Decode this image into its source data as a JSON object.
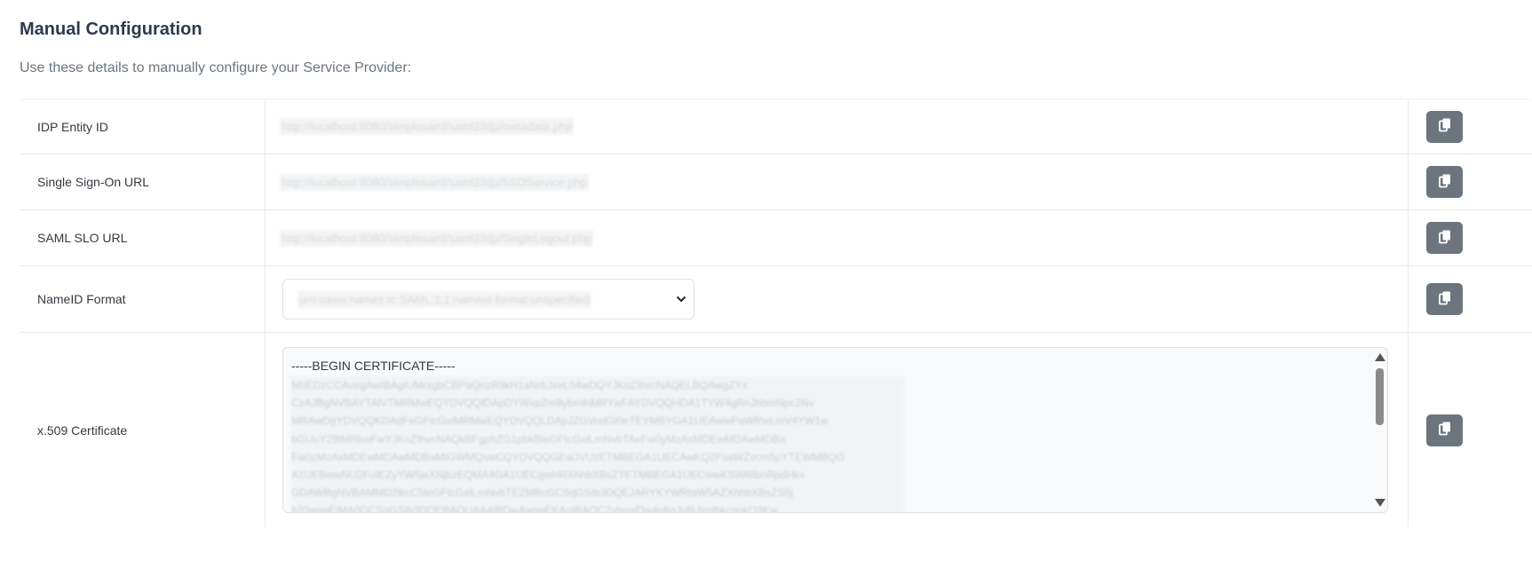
{
  "header": {
    "title": "Manual Configuration",
    "subtitle": "Use these details to manually configure your Service Provider:"
  },
  "rows": [
    {
      "label": "IDP Entity ID",
      "value": "http://localhost:8080/simplesaml/saml2/idp/metadata.php"
    },
    {
      "label": "Single Sign-On URL",
      "value": "http://localhost:8080/simplesaml/saml2/idp/SSOService.php"
    },
    {
      "label": "SAML SLO URL",
      "value": "http://localhost:8080/simplesaml/saml2/idp/SingleLogout.php"
    },
    {
      "label": "NameID Format",
      "value": "urn:oasis:names:tc:SAML:1.1:nameid-format:unspecified"
    },
    {
      "label": "x.509 Certificate",
      "value": "-----BEGIN CERTIFICATE-----"
    }
  ],
  "certificate_lines": [
    "MIIEDzCCAvegAwIBAgIUMrxgbCBPaQnzR9kH1aNrbJxeL04wDQYJKoZIhvcNAQELBQAwgZYx",
    "CzAJBgNVBAYTAlVTMRMwEQYDVQQIDApDYWxpZm9ybmlhMRYwFAYDVQQHDA1TYW4gRnJhbmNpc2Nv",
    "MRAwDgYDVQQKDAdFeGFtcGxlMRMwEQYDVQQLDApJZGVudGl0eTEYMBYGA1UEAwwPaWRwLmV4YW1w",
    "bGUuY29tMRkwFwYJKoZIhvcNAQkBFgphZG1pbkBleGFtcGxlLmNvbTAeFw0yMzAxMDEwMDAwMDBa",
    "Fw0zMzAxMDEwMDAwMDBaMIGWMQswCQYDVQQGEwJVUzETMBEGA1UECAwKQ2FsaWZvcm5pYTEWMBQG",
    "A1UEBwwNU2FuIEZyYW5jaXNjbzEQMA4GA1UECgwHRXhhbXBsZTETMBEGA1UECwwKSWRlbnRpdHkx",
    "GDAWBgNVBAMMD2lkcC5leGFtcGxlLmNvbTEZMBcGCSqGSIb3DQEJARYKYWRtaW5AZXhhbXBsZS5j",
    "b20wggEiMA0GCSqGSIb3DQEBAQUAA4IBDwAwggEKAoIBAQC7vbqajDw4o6gJy8UtmIbkcpnkO3Kw"
  ],
  "icons": {
    "copy": "copy-icon",
    "select_arrow": "chevron-down-icon"
  },
  "colors": {
    "copy_button": "#6c757d",
    "title": "#2d3a4b"
  }
}
